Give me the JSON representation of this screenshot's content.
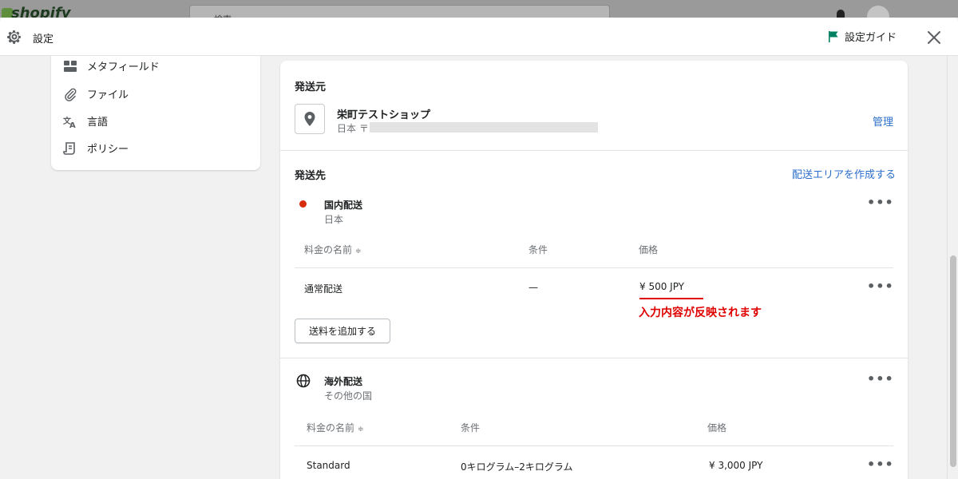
{
  "background": {
    "logo_text": "shopify",
    "search_placeholder": "検索"
  },
  "header": {
    "title": "設定",
    "setup_guide": "設定ガイド"
  },
  "sidebar": {
    "items": [
      {
        "label": "メタフィールド",
        "icon": "metafields-icon"
      },
      {
        "label": "ファイル",
        "icon": "paperclip-icon"
      },
      {
        "label": "言語",
        "icon": "translate-icon"
      },
      {
        "label": "ポリシー",
        "icon": "policy-icon"
      }
    ]
  },
  "origin": {
    "title": "発送元",
    "shop_name": "栄町テストショップ",
    "address_prefix": "日本 〒",
    "manage_link": "管理"
  },
  "destination": {
    "title": "発送先",
    "create_zone_link": "配送エリアを作成する",
    "domestic": {
      "name": "国内配送",
      "countries": "日本",
      "headers": {
        "rate_name": "料金の名前",
        "condition": "条件",
        "price": "価格"
      },
      "rows": [
        {
          "name": "通常配送",
          "condition": "—",
          "price": "¥ 500 JPY"
        }
      ],
      "annotation": "入力内容が反映されます",
      "add_rate_button": "送料を追加する"
    },
    "international": {
      "name": "海外配送",
      "countries": "その他の国",
      "headers": {
        "rate_name": "料金の名前",
        "condition": "条件",
        "price": "価格"
      },
      "rows": [
        {
          "name": "Standard",
          "condition": "0キログラム–2キログラム",
          "price": "¥ 3,000 JPY"
        }
      ]
    }
  },
  "more_actions": "•••",
  "sort_glyph": "≑",
  "colors": {
    "link": "#2c6ecb",
    "annotation": "#e00000",
    "domestic_dot": "#d72c0d",
    "flag": "#008060"
  }
}
